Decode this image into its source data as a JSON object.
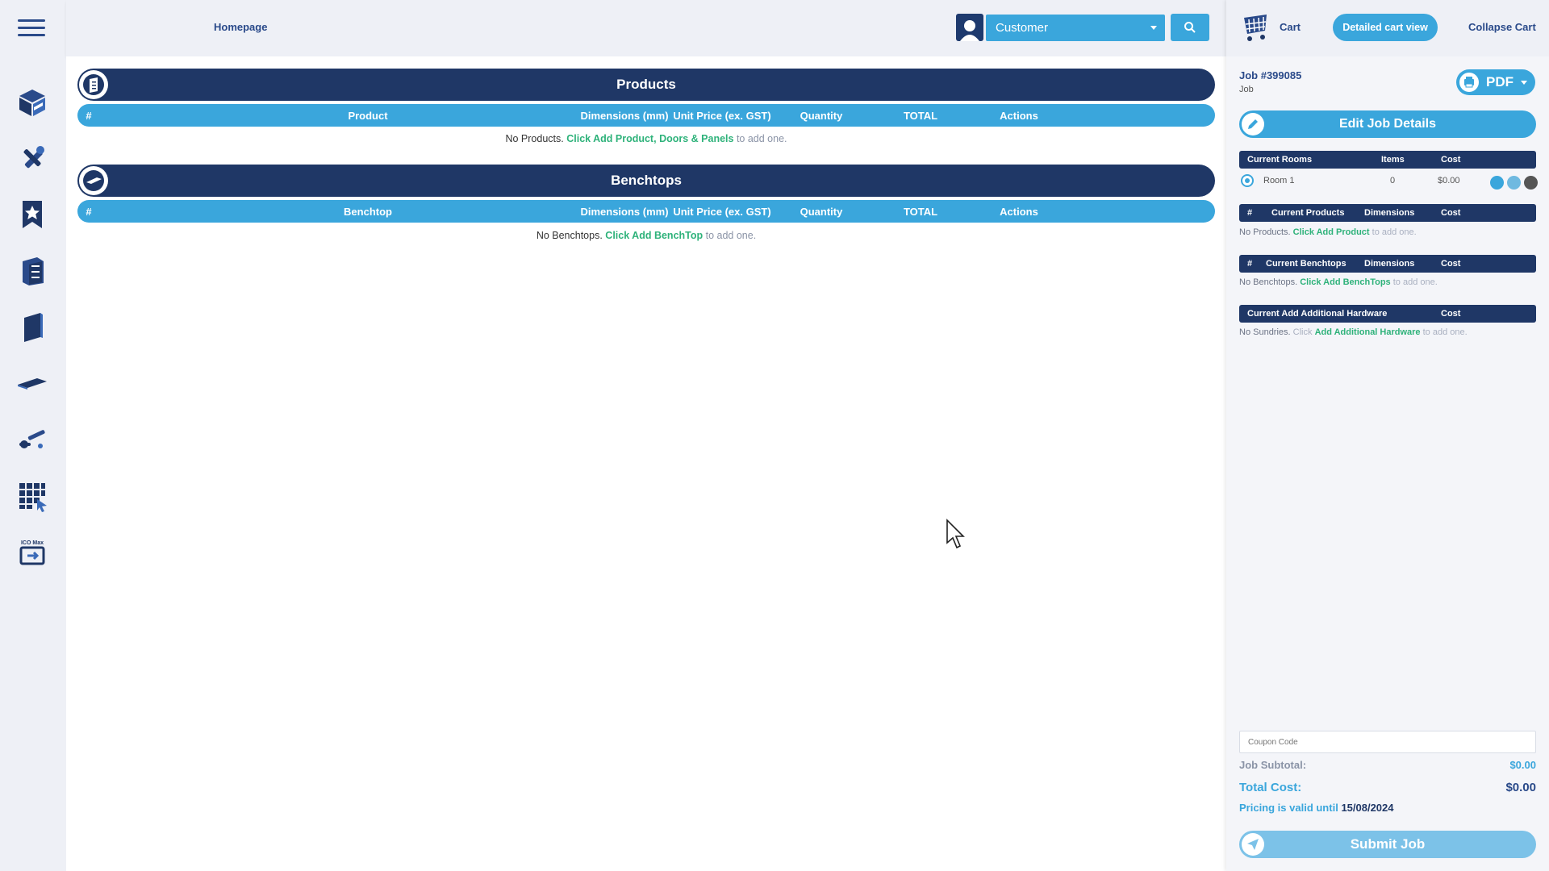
{
  "header": {
    "homepage_label": "Homepage",
    "customer_select_value": "Customer"
  },
  "sidebar": {
    "items": [
      {
        "icon": "box-3d-icon"
      },
      {
        "icon": "tools-icon"
      },
      {
        "icon": "star-bookmark-icon"
      },
      {
        "icon": "cabinet-icon"
      },
      {
        "icon": "door-panel-icon"
      },
      {
        "icon": "benchtop-icon"
      },
      {
        "icon": "hardware-icon"
      },
      {
        "icon": "grid-click-icon"
      },
      {
        "icon": "ico-max-icon"
      }
    ]
  },
  "products": {
    "title": "Products",
    "columns": [
      "#",
      "Product",
      "Dimensions (mm)",
      "Unit Price (ex. GST)",
      "Quantity",
      "TOTAL",
      "Actions"
    ],
    "empty_prefix": "No Products.",
    "empty_link1": "Click Add Product",
    "empty_sep": ",",
    "empty_link2": "Doors & Panels",
    "empty_suffix": "to add one."
  },
  "benchtops": {
    "title": "Benchtops",
    "columns": [
      "#",
      "Benchtop",
      "Dimensions (mm)",
      "Unit Price (ex. GST)",
      "Quantity",
      "TOTAL",
      "Actions"
    ],
    "empty_prefix": "No Benchtops.",
    "empty_link": "Click Add BenchTop",
    "empty_suffix": "to add one."
  },
  "cart": {
    "label": "Cart",
    "detailed_view_label": "Detailed cart view",
    "collapse_label": "Collapse Cart",
    "job_number": "Job #399085",
    "job_sub": "Job",
    "pdf_label": "PDF",
    "edit_job_label": "Edit Job Details",
    "rooms_table": {
      "headers": [
        "Current Rooms",
        "Items",
        "Cost"
      ],
      "rows": [
        {
          "name": "Room 1",
          "items": "0",
          "cost": "$0.00"
        }
      ]
    },
    "products_table": {
      "headers": [
        "#",
        "Current Products",
        "Dimensions",
        "Cost"
      ],
      "empty_prefix": "No Products.",
      "empty_link": "Click Add Product",
      "empty_suffix": "to add one."
    },
    "benchtops_table": {
      "headers": [
        "#",
        "Current Benchtops",
        "Dimensions",
        "Cost"
      ],
      "empty_prefix": "No Benchtops.",
      "empty_link": "Click Add BenchTops",
      "empty_suffix": "to add one."
    },
    "hardware_table": {
      "headers": [
        "Current Add Additional Hardware",
        "Cost"
      ],
      "empty_prefix": "No Sundries.",
      "empty_click": "Click",
      "empty_link": "Add Additional Hardware",
      "empty_suffix": "to add one."
    },
    "coupon_placeholder": "Coupon Code",
    "subtotal_label": "Job Subtotal:",
    "subtotal_value": "$0.00",
    "total_label": "Total Cost:",
    "total_value": "$0.00",
    "valid_prefix": "Pricing is valid until",
    "valid_date": "15/08/2024",
    "submit_label": "Submit Job"
  },
  "colors": {
    "navy": "#1f3766",
    "accent_blue": "#3aa6dc",
    "link_green": "#2eb27a",
    "panel_bg": "#eef0f6"
  }
}
